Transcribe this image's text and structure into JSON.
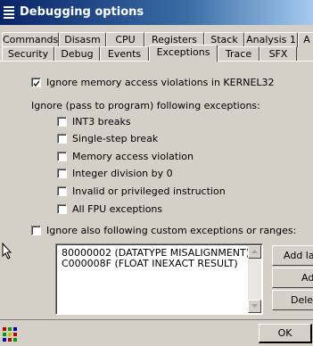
{
  "window": {
    "title": "Debugging options"
  },
  "tabs_row1": [
    {
      "label": "Commands"
    },
    {
      "label": "Disasm"
    },
    {
      "label": "CPU"
    },
    {
      "label": "Registers"
    },
    {
      "label": "Stack"
    },
    {
      "label": "Analysis 1"
    },
    {
      "label": "A"
    }
  ],
  "tabs_row2": [
    {
      "label": "Security"
    },
    {
      "label": "Debug"
    },
    {
      "label": "Events"
    },
    {
      "label": "Exceptions",
      "active": true
    },
    {
      "label": "Trace"
    },
    {
      "label": "SFX"
    }
  ],
  "exceptions": {
    "ignore_memory": {
      "label": "Ignore memory access violations in KERNEL32",
      "checked": true
    },
    "ignore_group_label": "Ignore (pass to program) following exceptions:",
    "options": [
      {
        "label": "INT3 breaks",
        "checked": false
      },
      {
        "label": "Single-step break",
        "checked": false
      },
      {
        "label": "Memory access violation",
        "checked": false
      },
      {
        "label": "Integer division by 0",
        "checked": false
      },
      {
        "label": "Invalid or privileged instruction",
        "checked": false
      },
      {
        "label": "All FPU exceptions",
        "checked": false
      }
    ],
    "custom": {
      "label": "Ignore also following custom exceptions or ranges:",
      "checked": false
    },
    "custom_list": [
      "80000002 (DATATYPE MISALIGNMENT)",
      "C000008F (FLOAT INEXACT RESULT)"
    ],
    "buttons": {
      "add_last": "Add la",
      "add": "Ad",
      "delete": "Delet"
    }
  },
  "footer": {
    "ok_label": "OK"
  }
}
